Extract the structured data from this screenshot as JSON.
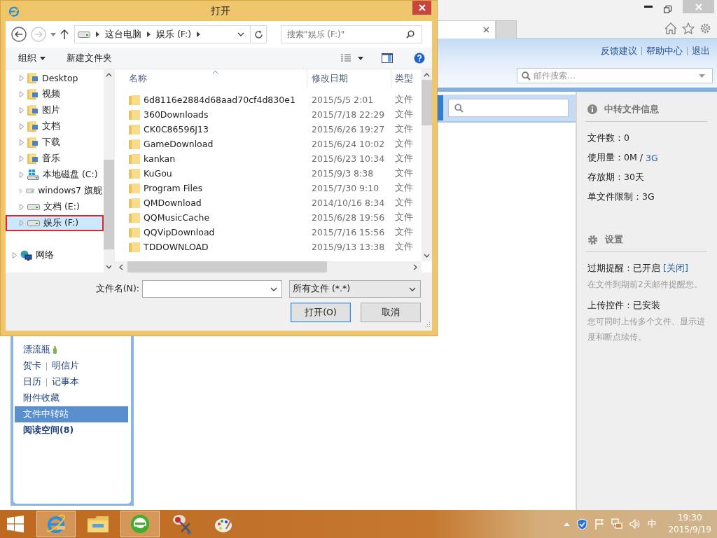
{
  "dialog": {
    "title": "打开",
    "breadcrumb": [
      "这台电脑",
      "娱乐 (F:)"
    ],
    "search": {
      "placeholder": "搜索\"娱乐 (F:)\""
    },
    "toolbar": {
      "organize": "组织",
      "new_folder": "新建文件夹"
    },
    "nav": [
      {
        "label": "Desktop",
        "kind": "folder",
        "selected": false
      },
      {
        "label": "视频",
        "kind": "folder",
        "selected": false
      },
      {
        "label": "图片",
        "kind": "folder",
        "selected": false
      },
      {
        "label": "文档",
        "kind": "folder",
        "selected": false
      },
      {
        "label": "下载",
        "kind": "folder",
        "selected": false
      },
      {
        "label": "音乐",
        "kind": "folder",
        "selected": false
      },
      {
        "label": "本地磁盘 (C:)",
        "kind": "system_drive",
        "selected": false
      },
      {
        "label": "windows7 旗舰",
        "kind": "drive",
        "selected": false
      },
      {
        "label": "文档 (E:)",
        "kind": "drive",
        "selected": false
      },
      {
        "label": "娱乐 (F:)",
        "kind": "drive",
        "selected": true
      },
      {
        "label": "网络",
        "kind": "network",
        "selected": false
      }
    ],
    "columns": [
      "名称",
      "修改日期",
      "类型"
    ],
    "files": [
      {
        "name": "6d8116e2884d68aad70cf4d830e1",
        "date": "2015/5/5 2:01",
        "type": "文件"
      },
      {
        "name": "360Downloads",
        "date": "2015/7/18 22:29",
        "type": "文件"
      },
      {
        "name": "CK0C86596J13",
        "date": "2015/6/26 19:27",
        "type": "文件"
      },
      {
        "name": "GameDownload",
        "date": "2015/6/24 10:02",
        "type": "文件"
      },
      {
        "name": "kankan",
        "date": "2015/6/23 10:34",
        "type": "文件"
      },
      {
        "name": "KuGou",
        "date": "2015/9/3 8:38",
        "type": "文件"
      },
      {
        "name": "Program Files",
        "date": "2015/7/30 9:10",
        "type": "文件"
      },
      {
        "name": "QMDownload",
        "date": "2014/10/16 8:34",
        "type": "文件"
      },
      {
        "name": "QQMusicCache",
        "date": "2015/6/28 19:56",
        "type": "文件"
      },
      {
        "name": "QQVipDownload",
        "date": "2015/7/16 15:56",
        "type": "文件"
      },
      {
        "name": "TDDOWNLOAD",
        "date": "2015/9/13 13:38",
        "type": "文件"
      }
    ],
    "filename": {
      "label": "文件名(N):"
    },
    "filter": {
      "value": "所有文件 (*.*)"
    },
    "buttons": [
      {
        "label": "打开(O)",
        "default": true
      },
      {
        "label": "取消",
        "default": false
      }
    ]
  },
  "browser": {
    "links": [
      "反馈建议",
      "帮助中心",
      "退出"
    ],
    "mail_search": {
      "placeholder": "邮件搜索…"
    },
    "sidebar": [
      {
        "kind": "bottle",
        "labels": [
          "漂流瓶"
        ],
        "selected": false,
        "bold": false
      },
      {
        "kind": "link",
        "labels": [
          "贺卡",
          "明信片"
        ],
        "selected": false,
        "bold": false
      },
      {
        "kind": "link",
        "labels": [
          "日历",
          "记事本"
        ],
        "selected": false,
        "bold": false
      },
      {
        "kind": "link",
        "labels": [
          "附件收藏"
        ],
        "selected": false,
        "bold": false
      },
      {
        "kind": "link",
        "labels": [
          "文件中转站"
        ],
        "selected": true,
        "bold": false
      },
      {
        "kind": "link",
        "labels": [
          "阅读空间(8)"
        ],
        "selected": false,
        "bold": true
      }
    ],
    "info": {
      "title": "中转文件信息",
      "rows": [
        {
          "text": "文件数：0"
        },
        {
          "text": "使用量：0M /",
          "link": "3G"
        },
        {
          "text": "存放期：30天"
        },
        {
          "text": "单文件限制：3G"
        }
      ]
    },
    "settings": {
      "title": "设置",
      "items": [
        {
          "text": "过期提醒：已开启",
          "link": "[关闭]",
          "note": "在文件到期前2天邮件提醒您。"
        },
        {
          "text": "上传控件：已安装",
          "note": "您可同时上传多个文件、显示进度和断点续传。"
        }
      ]
    }
  },
  "taskbar": {
    "apps": [
      {
        "kind": "ie",
        "active": true
      },
      {
        "kind": "explorer",
        "active": false
      },
      {
        "kind": "browser",
        "active": true
      },
      {
        "kind": "tool",
        "active": false
      },
      {
        "kind": "paint",
        "active": false
      }
    ],
    "ime": "中",
    "time": "19:30",
    "date": "2015/9/19"
  }
}
